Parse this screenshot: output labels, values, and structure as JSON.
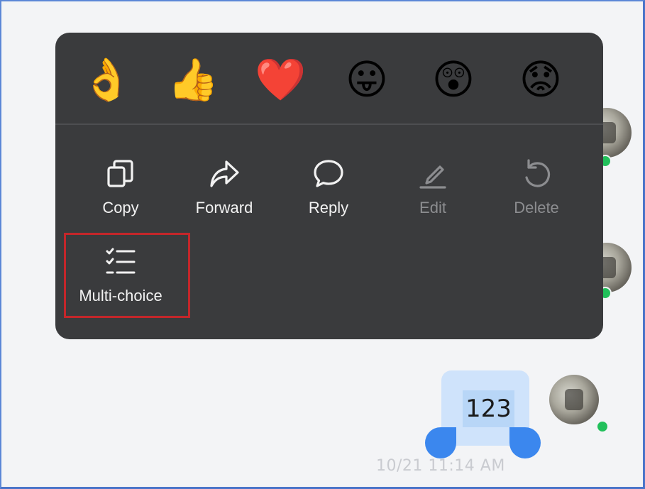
{
  "reactions": [
    {
      "name": "ok-hand-emoji",
      "glyph": "👌"
    },
    {
      "name": "thumbs-up-emoji",
      "glyph": "👍"
    },
    {
      "name": "heart-emoji",
      "glyph": "❤️"
    },
    {
      "name": "grinning-face-emoji",
      "glyph": "😛"
    },
    {
      "name": "astonished-face-emoji",
      "glyph": "😲"
    },
    {
      "name": "worried-face-emoji",
      "glyph": "😟"
    }
  ],
  "actions": [
    {
      "label": "Copy",
      "icon": "copy-icon",
      "enabled": true
    },
    {
      "label": "Forward",
      "icon": "forward-icon",
      "enabled": true
    },
    {
      "label": "Reply",
      "icon": "reply-icon",
      "enabled": true
    },
    {
      "label": "Edit",
      "icon": "edit-icon",
      "enabled": false
    },
    {
      "label": "Delete",
      "icon": "undo-delete-icon",
      "enabled": false
    },
    {
      "label": "Multi-choice",
      "icon": "checklist-icon",
      "enabled": true
    }
  ],
  "message": {
    "text": "123",
    "timestamp": "10/21 11:14 AM"
  },
  "colors": {
    "menu_background": "#3a3b3d",
    "bubble": "#cfe3fb",
    "selection_handle": "#3b87ee",
    "highlight_border": "#c4262a",
    "presence": "#22c05b"
  }
}
